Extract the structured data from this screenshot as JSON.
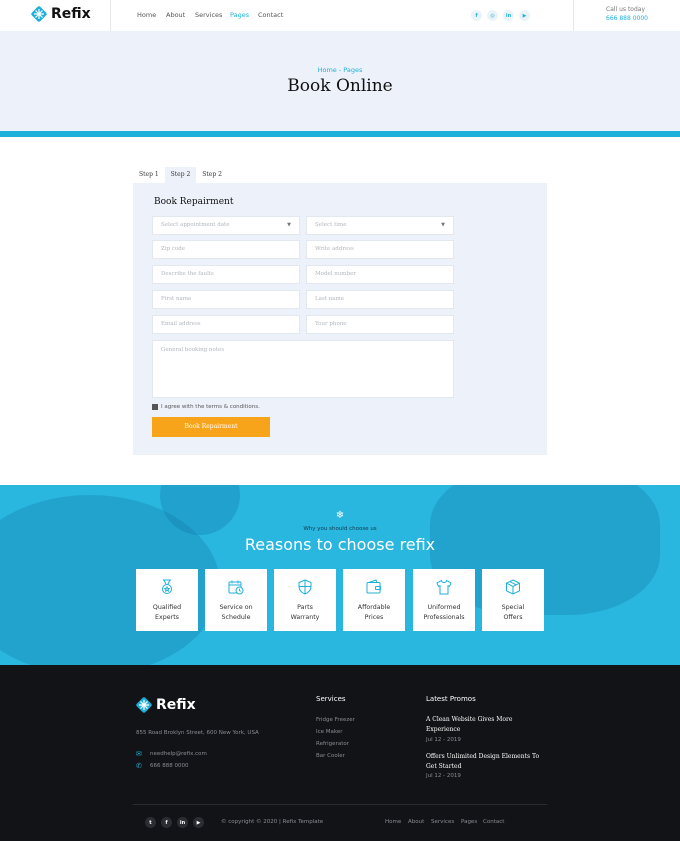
{
  "header": {
    "brand": "Refix",
    "nav": [
      "Home",
      "About",
      "Services",
      "Pages",
      "Contact"
    ],
    "active_nav": "Pages",
    "social_icons": [
      "facebook-icon",
      "instagram-icon",
      "linkedin-icon",
      "youtube-icon"
    ],
    "call_label": "Call us today",
    "phone": "666 888 0000"
  },
  "hero": {
    "breadcrumb": "Home - Pages",
    "title": "Book Online"
  },
  "booking": {
    "tabs": [
      "Step 1",
      "Step 2",
      "Step 2"
    ],
    "selected_tab": "Step 2",
    "title": "Book Repairment",
    "date_placeholder": "Select appointment date",
    "time_placeholder": "Select time",
    "zip_placeholder": "Zip code",
    "address_placeholder": "Write address",
    "faults_placeholder": "Describe the faults",
    "model_placeholder": "Model number",
    "first_name_placeholder": "First name",
    "last_name_placeholder": "Last name",
    "email_placeholder": "Email address",
    "phone_placeholder": "Your phone",
    "notes_placeholder": "General booking notes",
    "agree_text": "I agree with the terms & conditions.",
    "submit_label": "Book Repairment"
  },
  "reasons": {
    "eyebrow": "Why you should choose us",
    "title": "Reasons to choose refix",
    "items": [
      {
        "line1": "Qualified",
        "line2": "Experts",
        "icon": "medal-icon"
      },
      {
        "line1": "Service on",
        "line2": "Schedule",
        "icon": "calendar-clock-icon"
      },
      {
        "line1": "Parts",
        "line2": "Warranty",
        "icon": "shield-icon"
      },
      {
        "line1": "Affordable",
        "line2": "Prices",
        "icon": "wallet-icon"
      },
      {
        "line1": "Uniformed",
        "line2": "Professionals",
        "icon": "shirt-icon"
      },
      {
        "line1": "Special",
        "line2": "Offers",
        "icon": "box-icon"
      }
    ]
  },
  "footer": {
    "brand": "Refix",
    "address": "855 Road Broklyn Street, 600 New York, USA",
    "email": "needhelp@refix.com",
    "phone": "666 888 0000",
    "services_heading": "Services",
    "services": [
      "Fridge Freezer",
      "Ice Maker",
      "Refrigerator",
      "Bar Cooler"
    ],
    "promos_heading": "Latest Promos",
    "promos": [
      {
        "title": "A Clean Website Gives More Experience",
        "date": "Jul 12 - 2019"
      },
      {
        "title": "Offers Unlimited Design Elements To Get Started",
        "date": "Jul 12 - 2019"
      }
    ],
    "copyright": "© copyright © 2020 | Refix Template",
    "nav": [
      "Home",
      "About",
      "Services",
      "Pages",
      "Contact"
    ],
    "social_icons": [
      "twitter-icon",
      "facebook-icon",
      "linkedin-icon",
      "youtube-icon"
    ]
  },
  "colors": {
    "accent": "#1fb0da",
    "button": "#f8a41a",
    "hero_bg": "#edf2fa",
    "footer_bg": "#121317"
  }
}
